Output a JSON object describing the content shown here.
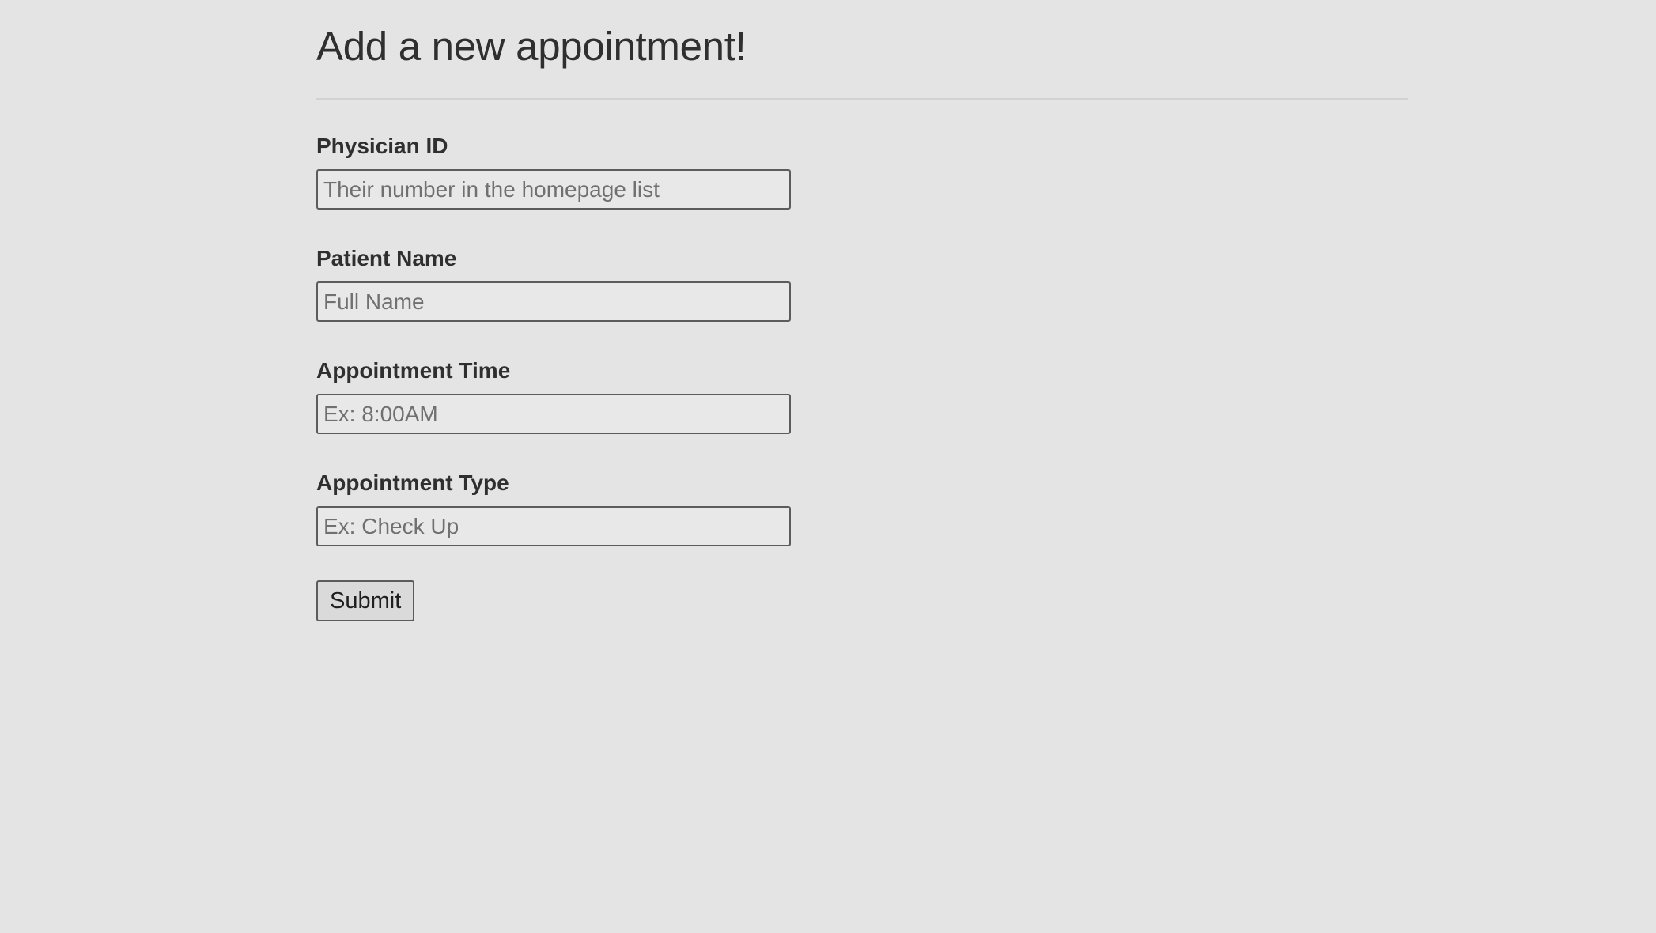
{
  "page": {
    "title": "Add a new appointment!"
  },
  "form": {
    "fields": [
      {
        "label": "Physician ID",
        "placeholder": "Their number in the homepage list",
        "value": ""
      },
      {
        "label": "Patient Name",
        "placeholder": "Full Name",
        "value": ""
      },
      {
        "label": "Appointment Time",
        "placeholder": "Ex: 8:00AM",
        "value": ""
      },
      {
        "label": "Appointment Type",
        "placeholder": "Ex: Check Up",
        "value": ""
      }
    ],
    "submit_label": "Submit"
  },
  "colors": {
    "background": "#e4e4e4",
    "text": "#2f2f2f",
    "input_border": "#5c5c5c",
    "divider": "#d2d2d2"
  }
}
